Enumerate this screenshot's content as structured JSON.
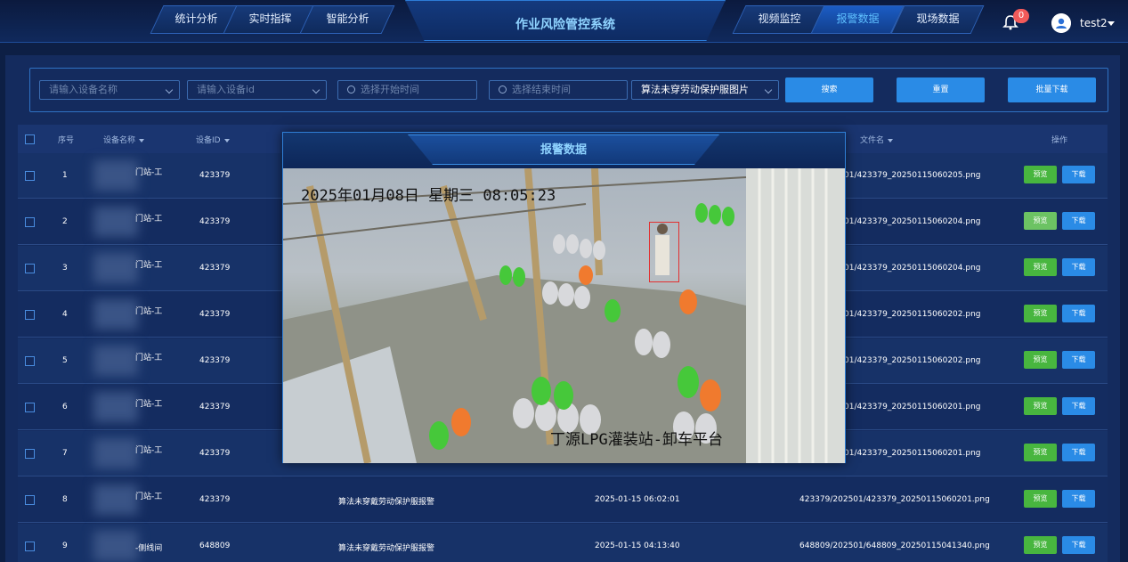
{
  "header": {
    "title": "作业风险管控系统",
    "left_tabs": [
      "统计分析",
      "实时指挥",
      "智能分析"
    ],
    "right_tabs": [
      "视频监控",
      "报警数据",
      "现场数据"
    ],
    "active_tab": "报警数据",
    "notification_count": "0",
    "username": "test2"
  },
  "filters": {
    "device_name_placeholder": "请输入设备名称",
    "device_id_placeholder": "请输入设备id",
    "start_time_placeholder": "选择开始时间",
    "end_time_placeholder": "选择结束时间",
    "alarm_type_value": "算法未穿劳动保护服图片",
    "search_label": "搜索",
    "reset_label": "重置",
    "batch_download_label": "批量下载"
  },
  "table": {
    "columns": {
      "index": "序号",
      "device_name": "设备名称",
      "device_id": "设备ID",
      "file_name": "文件名",
      "actions": "操作"
    },
    "preview_label": "预览",
    "download_label": "下载",
    "rows": [
      {
        "index": "1",
        "name_suffix": "门站-工",
        "device_id": "423379",
        "file_part": "01/423379_20250115060205.png"
      },
      {
        "index": "2",
        "name_suffix": "门站-工",
        "device_id": "423379",
        "file_part": "01/423379_20250115060204.png"
      },
      {
        "index": "3",
        "name_suffix": "门站-工",
        "device_id": "423379",
        "file_part": "01/423379_20250115060204.png"
      },
      {
        "index": "4",
        "name_suffix": "门站-工",
        "device_id": "423379",
        "file_part": "01/423379_20250115060202.png"
      },
      {
        "index": "5",
        "name_suffix": "门站-工",
        "device_id": "423379",
        "file_part": "01/423379_20250115060202.png"
      },
      {
        "index": "6",
        "name_suffix": "门站-工",
        "device_id": "423379",
        "file_part": "01/423379_20250115060201.png"
      },
      {
        "index": "7",
        "name_suffix": "门站-工",
        "device_id": "423379",
        "file_part": "01/423379_20250115060201.png"
      },
      {
        "index": "8",
        "name_suffix": "门站-工",
        "device_id": "423379",
        "alarm_type": "算法未穿戴劳动保护服报警",
        "time": "2025-01-15 06:02:01",
        "file_part": "423379/202501/423379_20250115060201.png"
      },
      {
        "index": "9",
        "name_suffix": "-侧线间",
        "device_id": "648809",
        "alarm_type": "算法未穿戴劳动保护服报警",
        "time": "2025-01-15 04:13:40",
        "file_part": "648809/202501/648809_20250115041340.png"
      }
    ]
  },
  "modal": {
    "title": "报警数据",
    "osd_time": "2025年01月08日  星期三  08:05:23",
    "osd_location": "丁源LPG灌装站-卸车平台"
  },
  "colors": {
    "background": "#0d1f45",
    "accent_blue": "#2a8be6",
    "preview_green": "#48b63f",
    "title_cyan": "#8fd3ff"
  }
}
